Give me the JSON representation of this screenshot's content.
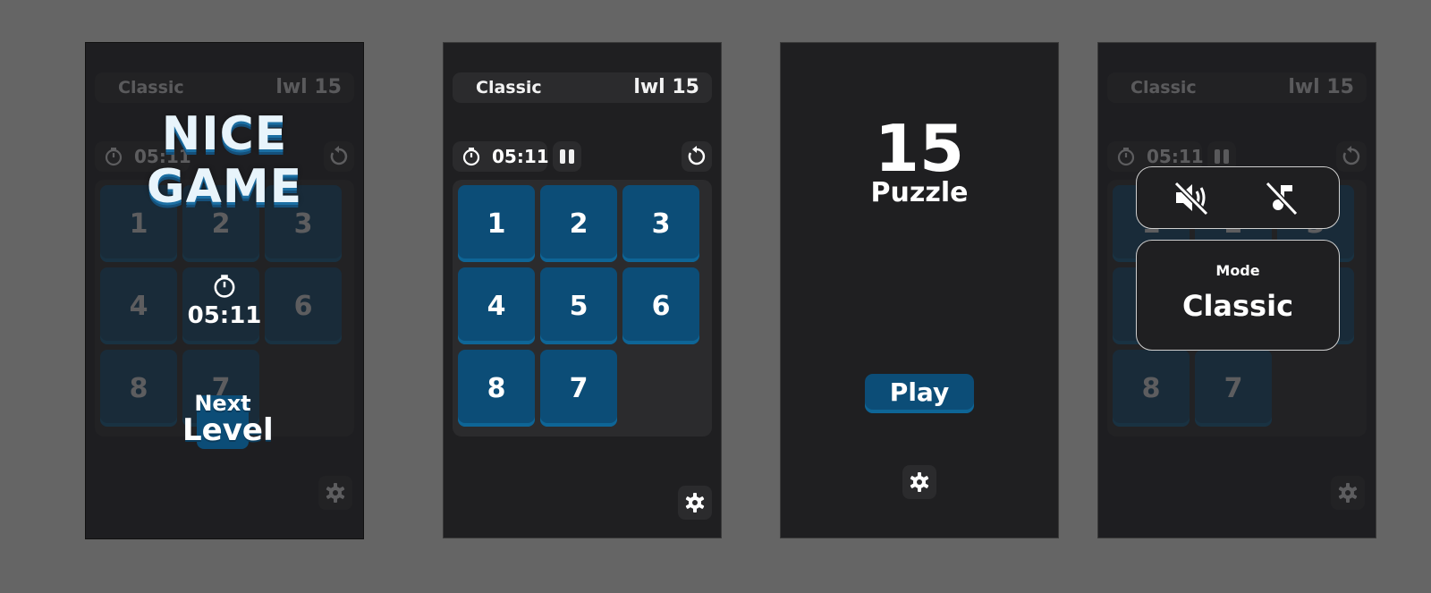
{
  "header": {
    "mode": "Classic",
    "level": "lwl 15"
  },
  "timer": {
    "value": "05:11"
  },
  "board": {
    "tiles": [
      "1",
      "2",
      "3",
      "4",
      "5",
      "6",
      "8",
      "7",
      ""
    ],
    "win_tiles": [
      "1",
      "2",
      "3",
      "4",
      "",
      "6",
      "8",
      "7",
      ""
    ]
  },
  "win_overlay": {
    "line1": "NICE",
    "line2": "GAME",
    "time": "05:11",
    "next_line1": "Next",
    "next_line2": "Level"
  },
  "menu": {
    "number": "15",
    "title": "Puzzle",
    "play_label": "Play"
  },
  "settings": {
    "mode_label": "Mode",
    "mode_value": "Classic"
  },
  "icons": {
    "timer": "stopwatch-icon",
    "pause": "pause-icon",
    "restart": "restart-icon",
    "settings": "gear-icon",
    "sound_off": "sound-muted-icon",
    "music_off": "music-muted-icon"
  },
  "colors": {
    "background": "#656565",
    "screen": "#1f1f21",
    "panel": "#2b2b2d",
    "tile": "#0c4d77",
    "tile_edge": "#0e6596"
  }
}
